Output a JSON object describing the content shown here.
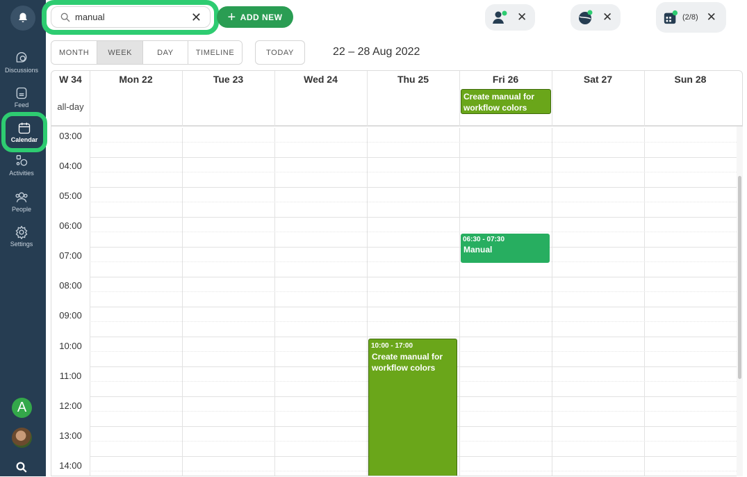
{
  "sidebar": {
    "items": [
      {
        "label": "Discussions",
        "icon": "discussions-icon"
      },
      {
        "label": "Feed",
        "icon": "feed-icon"
      },
      {
        "label": "Calendar",
        "icon": "calendar-icon",
        "active": true
      },
      {
        "label": "Activities",
        "icon": "activities-icon"
      },
      {
        "label": "People",
        "icon": "people-icon"
      },
      {
        "label": "Settings",
        "icon": "gear-icon"
      }
    ],
    "user_initial": "A"
  },
  "search": {
    "value": "manual",
    "placeholder": ""
  },
  "add_new_label": "ADD NEW",
  "filters": [
    {
      "icon": "people-filter-icon"
    },
    {
      "icon": "globe-filter-icon"
    },
    {
      "icon": "calendar-filter-icon",
      "count": "(2/8)"
    }
  ],
  "views": [
    "MONTH",
    "WEEK",
    "DAY",
    "TIMELINE"
  ],
  "active_view": "WEEK",
  "today_label": "TODAY",
  "date_range": "22 – 28 Aug 2022",
  "calendar": {
    "week_label": "W 34",
    "allday_label": "all-day",
    "days": [
      "Mon 22",
      "Tue 23",
      "Wed 24",
      "Thu 25",
      "Fri 26",
      "Sat 27",
      "Sun 28"
    ],
    "hours": [
      "03:00",
      "04:00",
      "05:00",
      "06:00",
      "07:00",
      "08:00",
      "09:00",
      "10:00",
      "11:00",
      "12:00",
      "13:00",
      "14:00"
    ],
    "allday_events": [
      {
        "day": "Fri 26",
        "title": "Create manual for workflow colors"
      }
    ],
    "events": [
      {
        "day": "Fri 26",
        "time": "06:30 - 07:30",
        "title": "Manual"
      },
      {
        "day": "Thu 25",
        "time": "10:00 - 17:00",
        "title": "Create manual for workflow colors"
      }
    ]
  },
  "colors": {
    "accent": "#2ecc71",
    "sidebar": "#263d52",
    "event_olive": "#6aa61a",
    "event_green": "#27ae60"
  }
}
